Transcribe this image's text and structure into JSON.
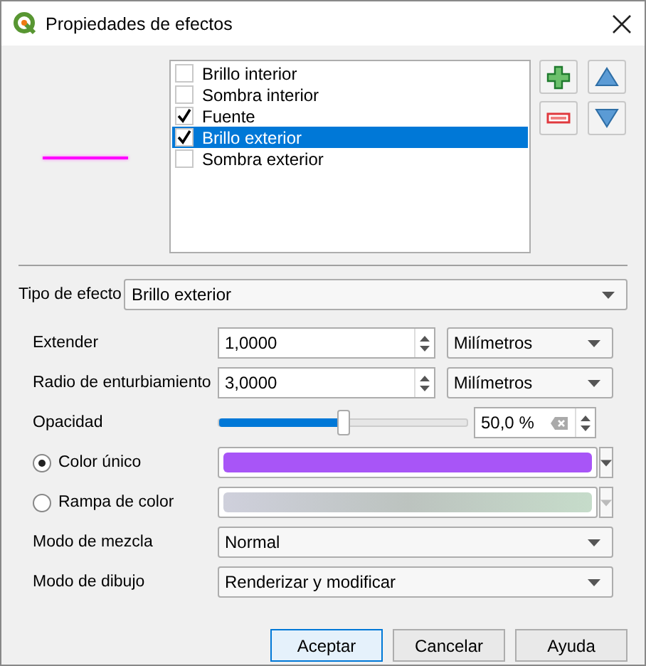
{
  "window": {
    "title": "Propiedades de efectos"
  },
  "effects": [
    {
      "label": "Brillo interior",
      "checked": false,
      "selected": false
    },
    {
      "label": "Sombra interior",
      "checked": false,
      "selected": false
    },
    {
      "label": "Fuente",
      "checked": true,
      "selected": false
    },
    {
      "label": "Brillo exterior",
      "checked": true,
      "selected": true
    },
    {
      "label": "Sombra exterior",
      "checked": false,
      "selected": false
    }
  ],
  "effect_type": {
    "label": "Tipo de efecto",
    "value": "Brillo exterior"
  },
  "extend": {
    "label": "Extender",
    "value": "1,0000",
    "unit": "Milímetros"
  },
  "blur_radius": {
    "label": "Radio de enturbiamiento",
    "value": "3,0000",
    "unit": "Milímetros"
  },
  "opacity": {
    "label": "Opacidad",
    "level": 0.5,
    "value": "50,0 %"
  },
  "color_modes": [
    {
      "kind": "single",
      "label": "Color único",
      "selected": true
    },
    {
      "kind": "ramp",
      "label": "Rampa de color",
      "selected": false
    }
  ],
  "blend_mode": {
    "label": "Modo de mezcla",
    "value": "Normal"
  },
  "draw_mode": {
    "label": "Modo de dibujo",
    "value": "Renderizar y modificar"
  },
  "buttons": [
    {
      "label": "Aceptar",
      "default": true
    },
    {
      "label": "Cancelar",
      "default": false
    },
    {
      "label": "Ayuda",
      "default": false
    }
  ]
}
